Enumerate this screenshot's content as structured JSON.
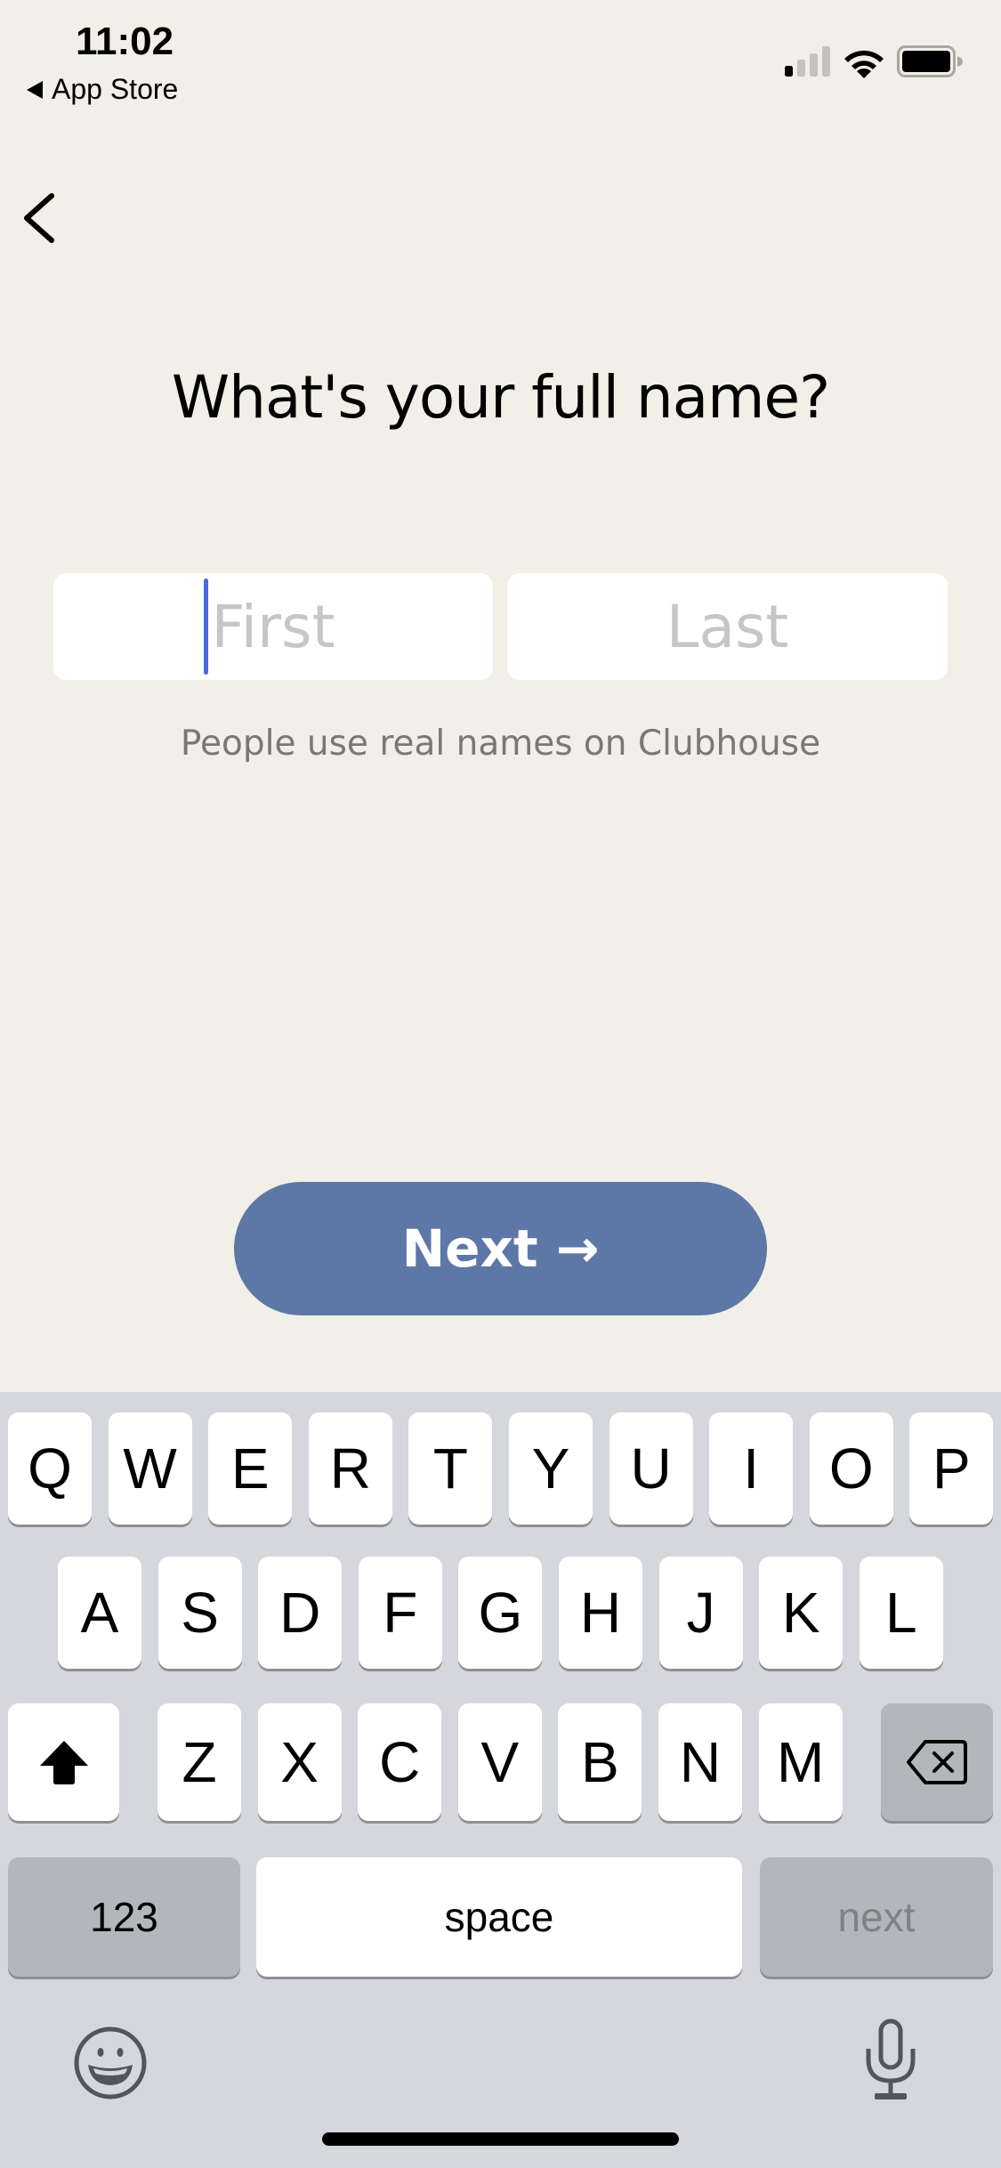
{
  "status_bar": {
    "time": "11:02",
    "back_app_label": "App Store",
    "signal_bars_active": 1,
    "signal_bars_total": 4,
    "wifi": "full",
    "battery": "high"
  },
  "page": {
    "title": "What's your full name?",
    "first_name": {
      "value": "",
      "placeholder": "First"
    },
    "last_name": {
      "value": "",
      "placeholder": "Last"
    },
    "hint": "People use real names on Clubhouse",
    "next_button": "Next →",
    "accent_color": "#5d77a6",
    "caret_color": "#4a6ae0"
  },
  "keyboard": {
    "row1": [
      "Q",
      "W",
      "E",
      "R",
      "T",
      "Y",
      "U",
      "I",
      "O",
      "P"
    ],
    "row2": [
      "A",
      "S",
      "D",
      "F",
      "G",
      "H",
      "J",
      "K",
      "L"
    ],
    "row3": [
      "Z",
      "X",
      "C",
      "V",
      "B",
      "N",
      "M"
    ],
    "numbers_label": "123",
    "space_label": "space",
    "return_label": "next"
  }
}
